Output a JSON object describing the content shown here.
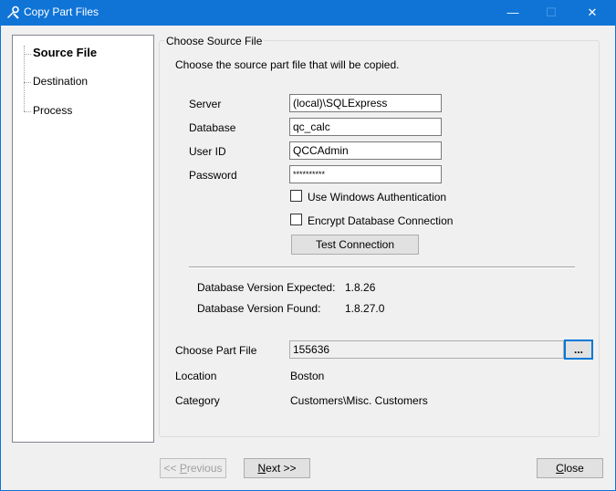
{
  "window": {
    "title": "Copy Part Files",
    "minimize_glyph": "—",
    "maximize_glyph": "☐",
    "close_glyph": "✕",
    "accent_color": "#0f74d6",
    "app_icon": "tools-icon"
  },
  "steps": {
    "items": [
      "Source File",
      "Destination",
      "Process"
    ],
    "active_index": 0
  },
  "group": {
    "title": "Choose Source File",
    "instruction": "Choose the source part file that will be copied."
  },
  "connection": {
    "server_label": "Server",
    "server_value": "(local)\\SQLExpress",
    "database_label": "Database",
    "database_value": "qc_calc",
    "userid_label": "User ID",
    "userid_value": "QCCAdmin",
    "password_label": "Password",
    "password_value": "**********",
    "windows_auth_label": "Use Windows Authentication",
    "windows_auth_checked": false,
    "encrypt_label": "Encrypt Database Connection",
    "encrypt_checked": false,
    "test_button": "Test Connection"
  },
  "version": {
    "expected_label": "Database Version Expected:",
    "expected_value": "1.8.26",
    "found_label": "Database Version Found:",
    "found_value": "1.8.27.0"
  },
  "part": {
    "choose_label": "Choose Part File",
    "choose_value": "155636",
    "browse_button": "...",
    "location_label": "Location",
    "location_value": "Boston",
    "category_label": "Category",
    "category_value": "Customers\\Misc. Customers"
  },
  "buttons": {
    "previous_prefix": "<< ",
    "previous_accel": "P",
    "previous_rest": "revious",
    "next_accel": "N",
    "next_rest": "ext >>",
    "close_accel": "C",
    "close_rest": "lose"
  }
}
